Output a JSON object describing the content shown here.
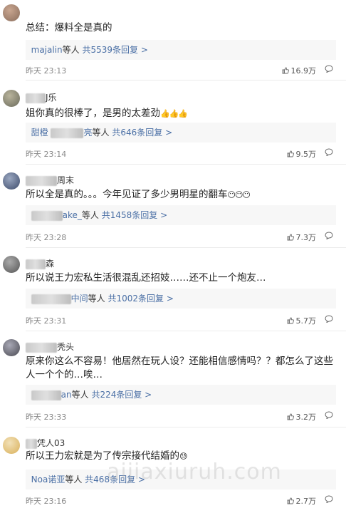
{
  "comments": [
    {
      "username": "",
      "text": "总结：爆料全是真的",
      "reply": {
        "names": "majalin",
        "who": "等人",
        "count": "共5539条回复 >"
      },
      "time": "昨天 23:13",
      "likes": "16.9万",
      "avatar_colors": [
        "#8a6d5c",
        "#c9a690"
      ]
    },
    {
      "username": "J乐",
      "text": "姐你真的很棒了，是男的太差劲",
      "emoji": "👍👍👍",
      "reply": {
        "names": "甜橙",
        "names2": "亮",
        "who": "等人",
        "count": "共646条回复 >"
      },
      "time": "昨天 23:14",
      "likes": "9.5万",
      "avatar_colors": [
        "#6b6b5c",
        "#b9b49c"
      ]
    },
    {
      "username": "周末",
      "text": "所以全是真的。。。今年见证了多少男明星的翻车",
      "emoji": "😶😶😶",
      "reply": {
        "names": "ake_",
        "who": "等人",
        "count": "共1458条回复 >"
      },
      "time": "昨天 23:28",
      "likes": "7.3万",
      "avatar_colors": [
        "#3d4b6b",
        "#9aa7c0"
      ]
    },
    {
      "username": "森",
      "text": "所以说王力宏私生活很混乱还招妓……还不止一个炮友…",
      "reply": {
        "names": "中间",
        "who": "等人",
        "count": "共1002条回复 >"
      },
      "time": "昨天 23:31",
      "likes": "5.7万",
      "avatar_colors": [
        "#555555",
        "#aaaaaa"
      ]
    },
    {
      "username": "秃头",
      "text": "原来你这么不容易！他居然在玩人设？还能相信感情吗？？都怎么了这些人一个个的…唉…",
      "reply": {
        "names": "an",
        "who": "等人",
        "count": "共224条回复 >"
      },
      "time": "昨天 23:33",
      "likes": "3.2万",
      "avatar_colors": [
        "#4a4a52",
        "#a8a8b5"
      ]
    },
    {
      "username": "凭人03",
      "text": "所以王力宏就是为了传宗接代结婚的",
      "emoji": "😓",
      "reply": {
        "names": "Noa诺亚",
        "who": "等人",
        "count": "共468条回复 >"
      },
      "time": "昨天 23:16",
      "likes": "2.7万",
      "avatar_colors": [
        "#d9b05a",
        "#f2e1b8"
      ]
    }
  ],
  "watermark": "aijiaxiuruh.com",
  "colors": {
    "link": "#4a6fa5",
    "meta": "#888888",
    "reply_bg": "#f7f7f7"
  }
}
